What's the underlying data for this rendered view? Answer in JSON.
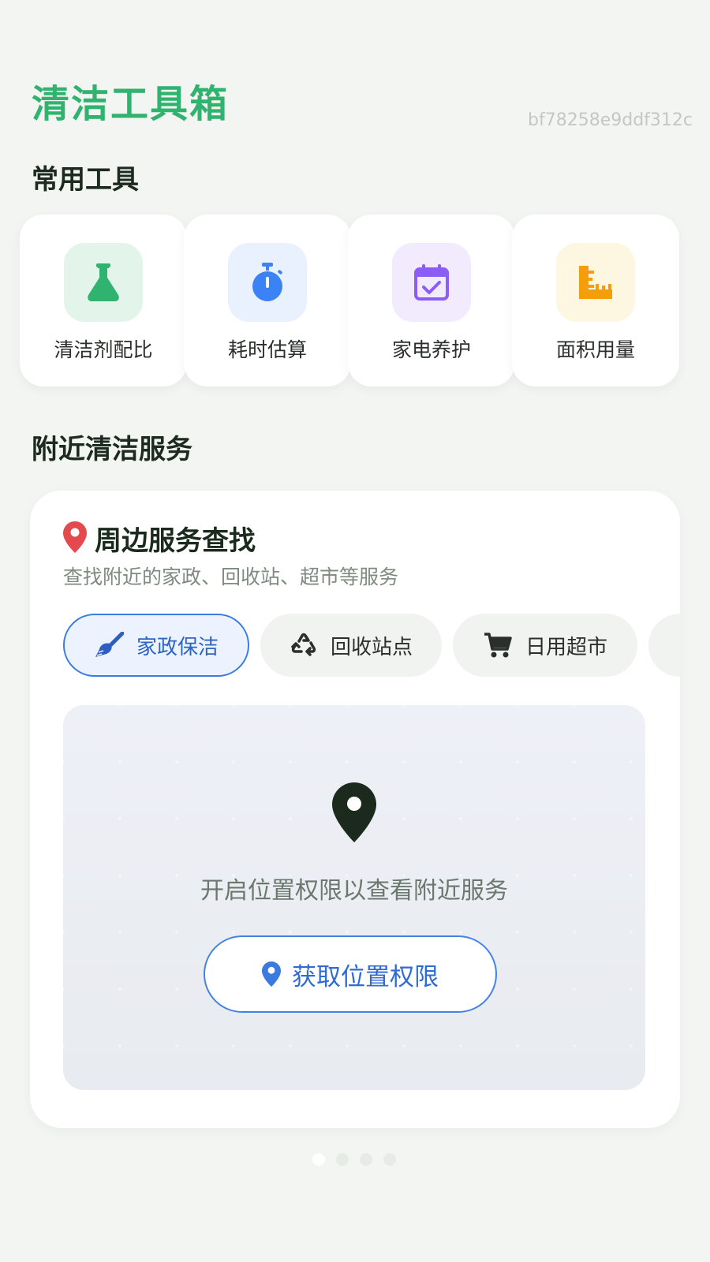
{
  "header": {
    "title": "清洁工具箱",
    "id_text": "bf78258e9ddf312c"
  },
  "tools_section": {
    "title": "常用工具",
    "items": [
      {
        "label": "清洁剂配比",
        "icon": "flask-icon",
        "color": "#2fb36f",
        "bg": "#e3f4ea"
      },
      {
        "label": "耗时估算",
        "icon": "stopwatch-icon",
        "color": "#3b82f6",
        "bg": "#e8f1fd"
      },
      {
        "label": "家电养护",
        "icon": "calendar-check-icon",
        "color": "#8b5cf6",
        "bg": "#f1ebfd"
      },
      {
        "label": "面积用量",
        "icon": "ruler-icon",
        "color": "#f59e0b",
        "bg": "#fdf6e1"
      }
    ]
  },
  "services_section": {
    "title": "附近清洁服务",
    "panel": {
      "title": "周边服务查找",
      "subtitle": "查找附近的家政、回收站、超市等服务",
      "chips": [
        {
          "label": "家政保洁",
          "icon": "broom-icon",
          "active": true
        },
        {
          "label": "回收站点",
          "icon": "recycle-icon",
          "active": false
        },
        {
          "label": "日用超市",
          "icon": "cart-icon",
          "active": false
        }
      ],
      "map": {
        "message": "开启位置权限以查看附近服务",
        "button_label": "获取位置权限"
      }
    }
  },
  "pagination": {
    "count": 4,
    "active_index": 0
  },
  "colors": {
    "accent_green": "#2fb36f",
    "accent_blue": "#3b7be0",
    "pin_red": "#e5484d",
    "background": "#f3f5f2"
  }
}
